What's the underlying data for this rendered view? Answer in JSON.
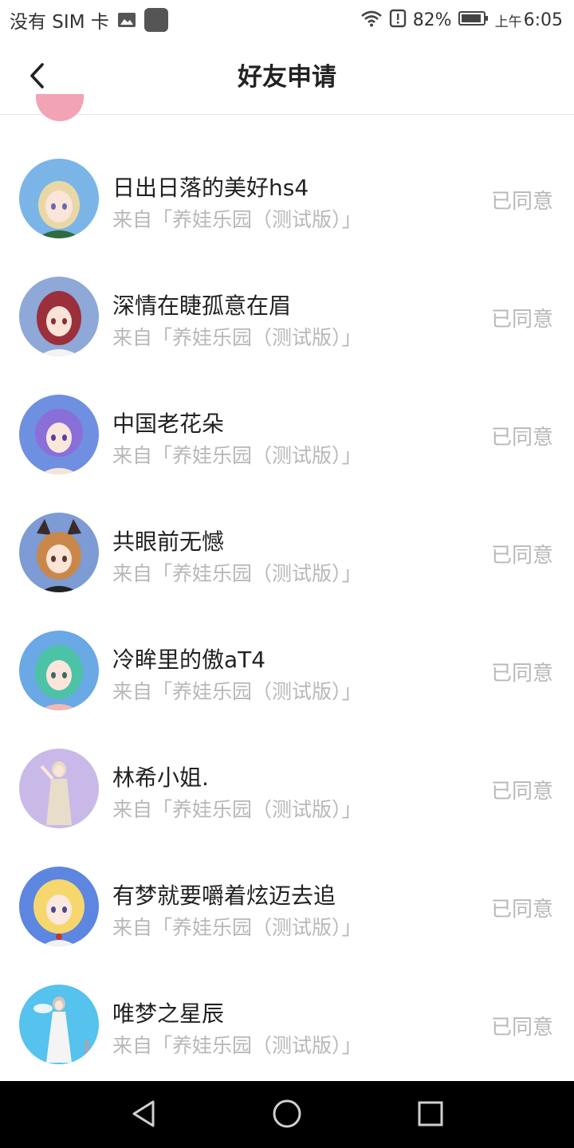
{
  "status_bar": {
    "carrier": "没有 SIM 卡",
    "battery": "82%",
    "ampm": "上午",
    "time": "6:05"
  },
  "header": {
    "title": "好友申请",
    "back_icon": "chevron-left-icon"
  },
  "requests": [
    {
      "name": "日出日落的美好hs4",
      "source": "来自「养娃乐园（测试版）」",
      "status": "已同意",
      "avatar_color": "#7bb5e8"
    },
    {
      "name": "深情在睫孤意在眉",
      "source": "来自「养娃乐园（测试版）」",
      "status": "已同意",
      "avatar_color": "#8ea8d8"
    },
    {
      "name": "中国老花朵",
      "source": "来自「养娃乐园（测试版）」",
      "status": "已同意",
      "avatar_color": "#6f8fe0"
    },
    {
      "name": "共眼前无憾",
      "source": "来自「养娃乐园（测试版）」",
      "status": "已同意",
      "avatar_color": "#7d9bd4"
    },
    {
      "name": "冷眸里的傲aT4",
      "source": "来自「养娃乐园（测试版）」",
      "status": "已同意",
      "avatar_color": "#6aa8e6"
    },
    {
      "name": "林希小姐.",
      "source": "来自「养娃乐园（测试版）」",
      "status": "已同意",
      "avatar_color": "#c9b9e8"
    },
    {
      "name": "有梦就要嚼着炫迈去追",
      "source": "来自「养娃乐园（测试版）」",
      "status": "已同意",
      "avatar_color": "#5d86e0"
    },
    {
      "name": "唯梦之星辰",
      "source": "来自「养娃乐园（测试版）」",
      "status": "已同意",
      "avatar_color": "#56c2ee"
    }
  ],
  "colors": {
    "muted_text": "#b8b8b8",
    "primary_text": "#222222",
    "nav_bar": "#000000"
  }
}
